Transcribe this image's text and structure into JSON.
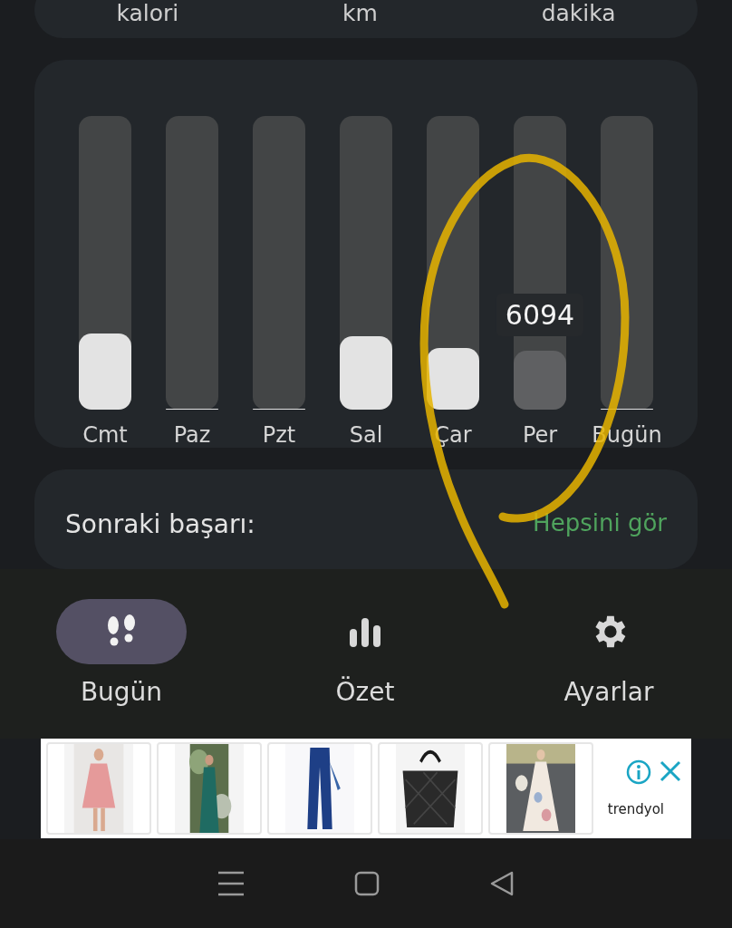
{
  "stats": [
    {
      "label": "kalori"
    },
    {
      "label": "km"
    },
    {
      "label": "dakika"
    }
  ],
  "week_chart": {
    "days": [
      {
        "label": "Cmt",
        "level": 0.26,
        "selected": false
      },
      {
        "label": "Paz",
        "level": 0,
        "selected": false
      },
      {
        "label": "Pzt",
        "level": 0,
        "selected": false
      },
      {
        "label": "Sal",
        "level": 0.25,
        "selected": false
      },
      {
        "label": "Çar",
        "level": 0.21,
        "selected": false
      },
      {
        "label": "Per",
        "level": 0.2,
        "selected": true,
        "tooltip": "6094"
      },
      {
        "label": "Bugün",
        "level": 0,
        "selected": false
      }
    ]
  },
  "next_card": {
    "title": "Sonraki başarı:",
    "link": "Hepsini gör"
  },
  "bottom_nav": [
    {
      "label": "Bugün",
      "selected": true
    },
    {
      "label": "Özet",
      "selected": false
    },
    {
      "label": "Ayarlar",
      "selected": false
    }
  ],
  "ad": {
    "brand": "trendyol"
  }
}
